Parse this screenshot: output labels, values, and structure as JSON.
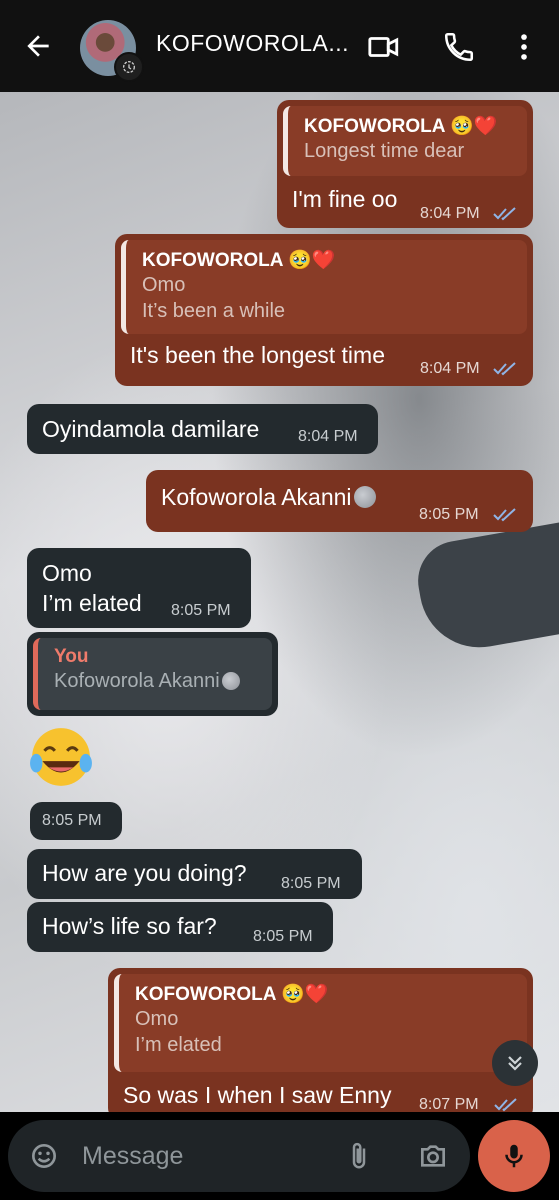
{
  "header": {
    "contact_name": "KOFOWOROLA...",
    "icons": [
      "back-arrow-icon",
      "video-call-icon",
      "phone-icon",
      "more-vert-icon"
    ]
  },
  "messages": [
    {
      "dir": "out",
      "quote": {
        "name": "KOFOWOROLA 🥹❤️",
        "lines": [
          "Longest time dear"
        ]
      },
      "text": "I'm fine oo",
      "time": "8:04 PM",
      "ticks": "read"
    },
    {
      "dir": "out",
      "quote": {
        "name": "KOFOWOROLA 🥹❤️",
        "lines": [
          "Omo",
          "It’s been a while"
        ]
      },
      "text": "It's been the longest time",
      "time": "8:04 PM",
      "ticks": "read"
    },
    {
      "dir": "in",
      "text": "Oyindamola damilare",
      "time": "8:04 PM"
    },
    {
      "dir": "out",
      "text": "Kofoworola Akanni",
      "time": "8:05 PM",
      "ticks": "read"
    },
    {
      "dir": "in",
      "lines": [
        "Omo",
        "I’m elated"
      ],
      "time": "8:05 PM"
    },
    {
      "dir": "in",
      "quote": {
        "name": "You",
        "lines": [
          "Kofoworola Akanni"
        ]
      },
      "emoji": "😂",
      "time": "8:05 PM"
    },
    {
      "dir": "in",
      "text": "How are you doing?",
      "time": "8:05 PM"
    },
    {
      "dir": "in",
      "text": "How’s life so far?",
      "time": "8:05 PM"
    },
    {
      "dir": "out",
      "quote": {
        "name": "KOFOWOROLA 🥹❤️",
        "lines": [
          "Omo",
          "I’m elated"
        ]
      },
      "text": "So was I when I saw Enny",
      "time": "8:07 PM",
      "ticks": "read"
    }
  ],
  "composer": {
    "placeholder": "Message"
  },
  "colors": {
    "outgoing": "#7a3320",
    "incoming": "#232a2e",
    "mic": "#d9624a",
    "read_ticks": "#8fb4e6"
  }
}
